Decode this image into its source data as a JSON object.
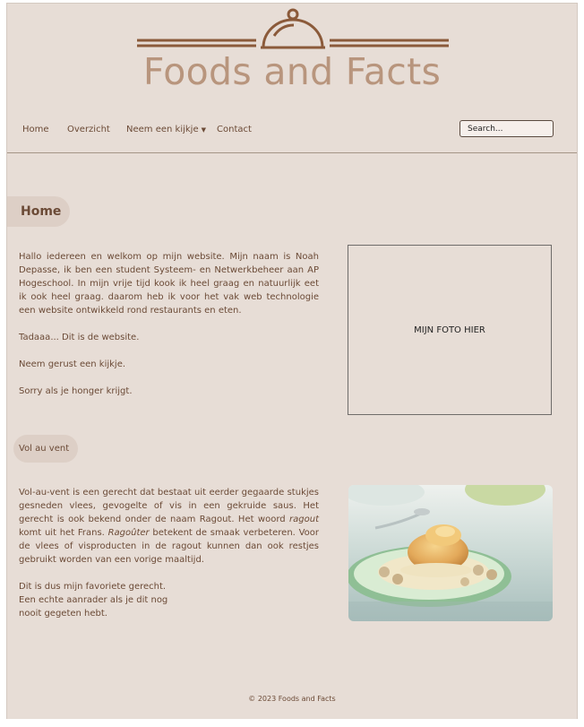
{
  "brand": {
    "name": "Foods and Facts"
  },
  "nav": {
    "items": [
      {
        "label": "Home"
      },
      {
        "label": "Overzicht"
      },
      {
        "label": "Neem een kijkje",
        "has_dropdown": true
      },
      {
        "label": "Contact"
      }
    ],
    "search_placeholder": "Search..."
  },
  "home": {
    "heading": "Home",
    "paragraph1": "Hallo iedereen en welkom op mijn website. Mijn naam is Noah Depasse, ik ben een student Systeem- en Netwerkbeheer aan AP Hogeschool. In mijn vrije tijd kook ik heel graag en natuurlijk eet ik ook heel graag. daarom heb ik voor het vak web technologie een website ontwikkeld rond restaurants en eten.",
    "paragraph2": "Tadaaa... Dit is de website.",
    "paragraph3": "Neem gerust een kijkje.",
    "paragraph4": "Sorry als je honger krijgt.",
    "photo_placeholder": "MIJN FOTO HIER"
  },
  "vol_au_vent": {
    "heading": "Vol au vent",
    "p1_part1": "Vol-au-vent is een gerecht dat bestaat uit eerder gegaarde stukjes gesneden vlees, gevogelte of vis in een gekruide saus. Het gerecht is ook bekend onder de naam Ragout. Het woord ",
    "p1_em1": "ragout",
    "p1_part2": " komt uit het Frans. ",
    "p1_em2": "Ragoûter",
    "p1_part3": " betekent de smaak verbeteren. Voor de vlees of visproducten in de ragout kunnen dan ook restjes gebruikt worden van een vorige maaltijd.",
    "p2_line1": "Dit is dus mijn favoriete gerecht.",
    "p2_line2": "Een echte aanrader als je dit nog",
    "p2_line3": "nooit gegeten hebt."
  },
  "footer": {
    "text": "© 2023 Foods and Facts"
  },
  "colors": {
    "background": "#e7ddd6",
    "brand_brown": "#8b5a3a",
    "logo_text": "#b8957d",
    "text": "#6b4a36",
    "pill": "#ddcfc6"
  }
}
